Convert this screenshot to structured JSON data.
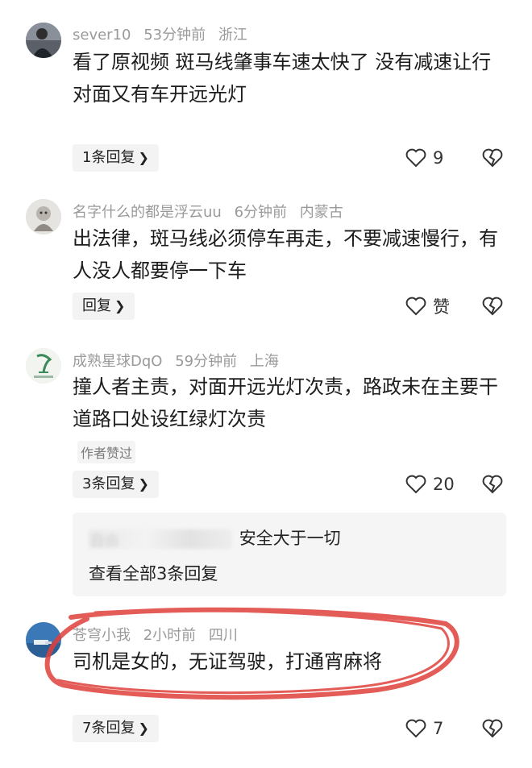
{
  "comments": [
    {
      "username": "sever10",
      "time": "53分钟前",
      "location": "浙江",
      "text": "看了原视频 斑马线肇事车速太快了 没有减速让行 对面又有车开远光灯",
      "reply_label": "1条回复",
      "likes": "9"
    },
    {
      "username": "名字什么的都是浮云uu",
      "time": "6分钟前",
      "location": "内蒙古",
      "text": "出法律，斑马线必须停车再走，不要减速慢行，有人没人都要停一下车",
      "reply_label": "回复",
      "likes": "赞"
    },
    {
      "username": "成熟星球DqO",
      "time": "59分钟前",
      "location": "上海",
      "text": "撞人者主责，对面开远光灯次责，路政未在主要干道路口处设红绿灯次责",
      "author_liked": "作者赞过",
      "reply_label": "3条回复",
      "likes": "20",
      "sub_reply": {
        "username": "自由",
        "text": "安全大于一切",
        "see_all": "查看全部3条回复"
      }
    },
    {
      "username": "苍穹小我",
      "time": "2小时前",
      "location": "四川",
      "text": "司机是女的，无证驾驶，打通宵麻将",
      "reply_label": "7条回复",
      "likes": "7"
    }
  ],
  "icons": {
    "like": "heart-outline-icon",
    "dislike": "broken-heart-icon",
    "chevron": "chevron-right-icon"
  },
  "colors": {
    "meta_text": "#9a9a9a",
    "body_text": "#1c1c1c",
    "annotation_red": "#e0403a",
    "reply_bg": "#f3f3f3"
  }
}
